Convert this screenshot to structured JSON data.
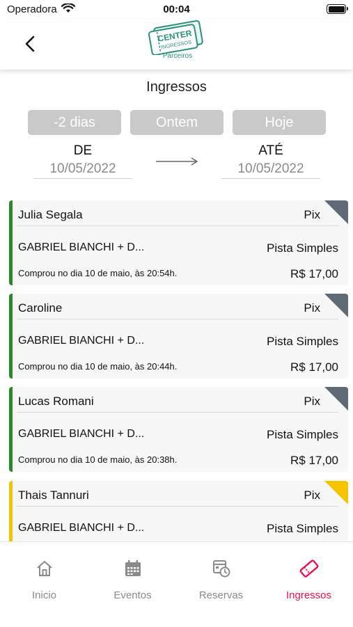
{
  "status": {
    "carrier": "Operadora",
    "time": "00:04"
  },
  "header": {
    "logo_text_main": "CENTER",
    "logo_text_sub": "INGRESSOS",
    "logo_caption": "Parceiros"
  },
  "page_title": "Ingressos",
  "quick_filters": [
    "-2 dias",
    "Ontem",
    "Hoje"
  ],
  "date_range": {
    "from_label": "DE",
    "from_value": "10/05/2022",
    "to_label": "ATÉ",
    "to_value": "10/05/2022"
  },
  "colors": {
    "accent": "#e8134b",
    "paid": "#2a8a2a",
    "pending": "#f5c400",
    "corner": "#5f6a74",
    "button_gray": "#c9c9c9"
  },
  "tickets": [
    {
      "name": "Julia Segala",
      "payment": "Pix",
      "event": "GABRIEL BIANCHI + D...",
      "ticket_type": "Pista Simples",
      "bought": "Comprou no dia 10 de maio, às 20:54h.",
      "price": "R$ 17,00",
      "status": "paid"
    },
    {
      "name": "Caroline",
      "payment": "Pix",
      "event": "GABRIEL BIANCHI + D...",
      "ticket_type": "Pista Simples",
      "bought": "Comprou no dia 10 de maio, às 20:44h.",
      "price": "R$ 17,00",
      "status": "paid"
    },
    {
      "name": "Lucas Romani",
      "payment": "Pix",
      "event": "GABRIEL BIANCHI + D...",
      "ticket_type": "Pista Simples",
      "bought": "Comprou no dia 10 de maio, às 20:38h.",
      "price": "R$ 17,00",
      "status": "paid"
    },
    {
      "name": "Thais Tannuri",
      "payment": "Pix",
      "event": "GABRIEL BIANCHI + D...",
      "ticket_type": "Pista Simples",
      "bought": "",
      "price": "",
      "status": "pending"
    }
  ],
  "tabs": [
    {
      "label": "Inicio",
      "icon": "home-icon",
      "active": false
    },
    {
      "label": "Eventos",
      "icon": "calendar-icon",
      "active": false
    },
    {
      "label": "Reservas",
      "icon": "reservations-icon",
      "active": false
    },
    {
      "label": "Ingressos",
      "icon": "ticket-icon",
      "active": true
    }
  ]
}
